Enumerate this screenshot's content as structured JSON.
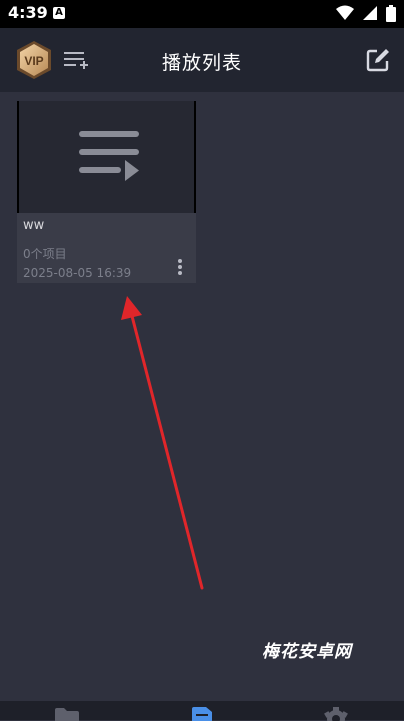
{
  "status_bar": {
    "time": "4:39",
    "notification_letter": "A"
  },
  "header": {
    "title": "播放列表",
    "vip_label": "VIP"
  },
  "playlist_cards": [
    {
      "name": "ww",
      "item_count": "0个项目",
      "date": "2025-08-05 16:39"
    }
  ],
  "watermark": "梅花安卓网",
  "bottom_nav": {
    "items": [
      "folder-icon",
      "playlist-icon",
      "settings-icon"
    ],
    "active_index": 1
  },
  "colors": {
    "background": "#2f313e",
    "header": "#222530",
    "accent": "#4a8fe7",
    "annotation_arrow": "#e0262a"
  }
}
